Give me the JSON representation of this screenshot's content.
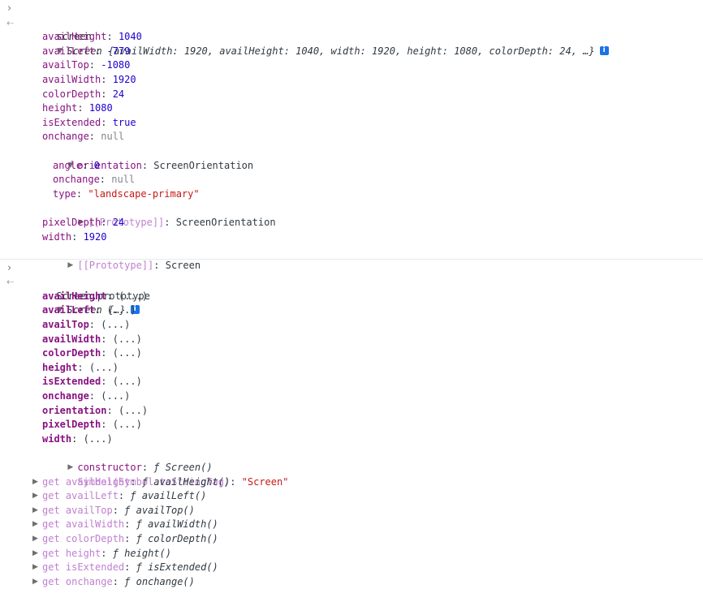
{
  "console": {
    "entry1": {
      "command": "screen",
      "summary_name": "Screen",
      "summary_props": "{availWidth: 1920, availHeight: 1040, width: 1920, height: 1080, colorDepth: 24, …}",
      "info": "i",
      "props": [
        {
          "key": "availHeight",
          "value": "1040",
          "kind": "num"
        },
        {
          "key": "availLeft",
          "value": "-779",
          "kind": "num"
        },
        {
          "key": "availTop",
          "value": "-1080",
          "kind": "num"
        },
        {
          "key": "availWidth",
          "value": "1920",
          "kind": "num"
        },
        {
          "key": "colorDepth",
          "value": "24",
          "kind": "num"
        },
        {
          "key": "height",
          "value": "1080",
          "kind": "num"
        },
        {
          "key": "isExtended",
          "value": "true",
          "kind": "num"
        },
        {
          "key": "onchange",
          "value": "null",
          "kind": "nul"
        }
      ],
      "orientation": {
        "key": "orientation",
        "value": "ScreenOrientation",
        "props": [
          {
            "key": "angle",
            "value": "0",
            "kind": "num"
          },
          {
            "key": "onchange",
            "value": "null",
            "kind": "nul"
          },
          {
            "key": "type",
            "value": "\"landscape-primary\"",
            "kind": "str"
          }
        ],
        "proto_key": "[[Prototype]]",
        "proto_value": "ScreenOrientation"
      },
      "props_after": [
        {
          "key": "pixelDepth",
          "value": "24",
          "kind": "num"
        },
        {
          "key": "width",
          "value": "1920",
          "kind": "num"
        }
      ],
      "proto_key": "[[Prototype]]",
      "proto_value": "Screen"
    },
    "entry2": {
      "command": "Screen.prototype",
      "summary_name": "Screen",
      "summary_props": "{…}",
      "info": "i",
      "accessors": [
        {
          "key": "availHeight",
          "value": "(...)"
        },
        {
          "key": "availLeft",
          "value": "(...)"
        },
        {
          "key": "availTop",
          "value": "(...)"
        },
        {
          "key": "availWidth",
          "value": "(...)"
        },
        {
          "key": "colorDepth",
          "value": "(...)"
        },
        {
          "key": "height",
          "value": "(...)"
        },
        {
          "key": "isExtended",
          "value": "(...)"
        },
        {
          "key": "onchange",
          "value": "(...)"
        },
        {
          "key": "orientation",
          "value": "(...)"
        },
        {
          "key": "pixelDepth",
          "value": "(...)"
        },
        {
          "key": "width",
          "value": "(...)"
        }
      ],
      "constructor": {
        "key": "constructor",
        "f": "ƒ",
        "value": "Screen()"
      },
      "symbol": {
        "key": "Symbol(Symbol.toStringTag)",
        "value": "\"Screen\""
      },
      "getters": [
        {
          "key": "get availHeight",
          "f": "ƒ",
          "value": "availHeight()"
        },
        {
          "key": "get availLeft",
          "f": "ƒ",
          "value": "availLeft()"
        },
        {
          "key": "get availTop",
          "f": "ƒ",
          "value": "availTop()"
        },
        {
          "key": "get availWidth",
          "f": "ƒ",
          "value": "availWidth()"
        },
        {
          "key": "get colorDepth",
          "f": "ƒ",
          "value": "colorDepth()"
        },
        {
          "key": "get height",
          "f": "ƒ",
          "value": "height()"
        },
        {
          "key": "get isExtended",
          "f": "ƒ",
          "value": "isExtended()"
        },
        {
          "key": "get onchange",
          "f": "ƒ",
          "value": "onchange()"
        }
      ]
    }
  }
}
